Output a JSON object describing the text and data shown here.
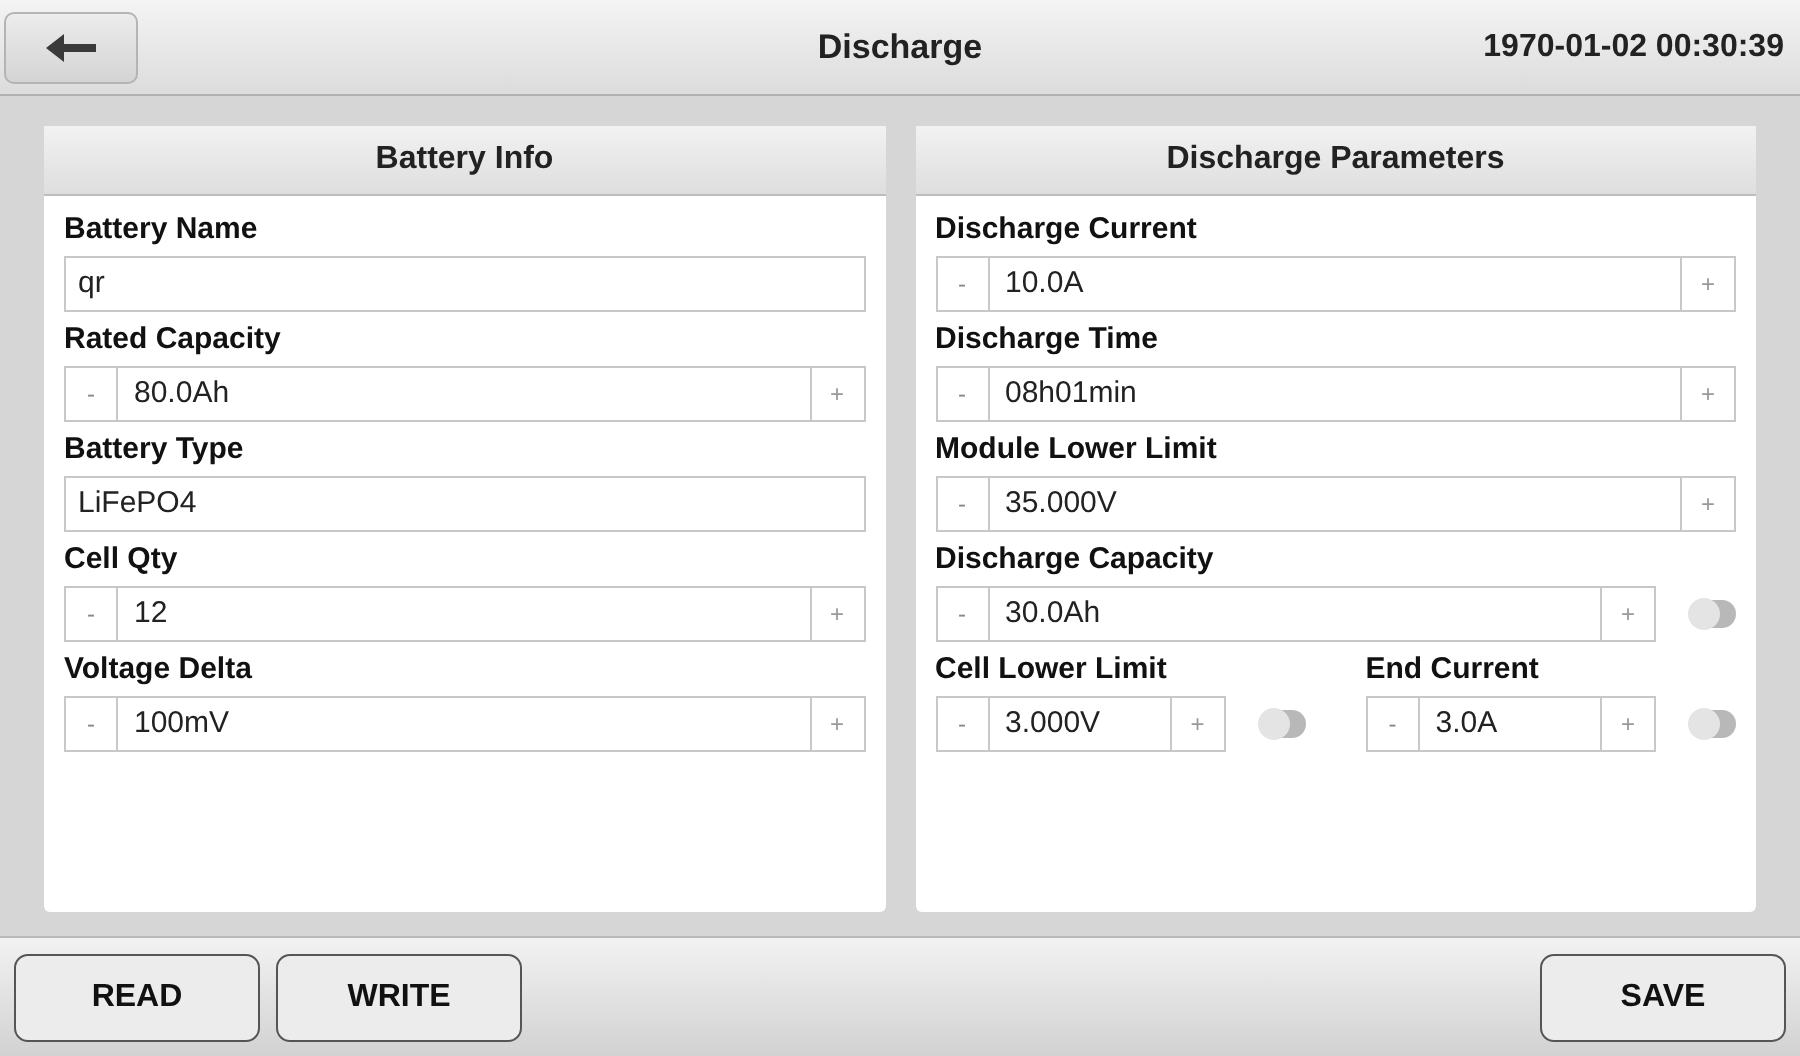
{
  "header": {
    "title": "Discharge",
    "datetime": "1970-01-02 00:30:39"
  },
  "panels": [
    {
      "title": "Battery Info",
      "rows": [
        [
          {
            "label": "Battery Name",
            "kind": "text",
            "value": "qr"
          }
        ],
        [
          {
            "label": "Rated Capacity",
            "kind": "stepper",
            "minus": "-",
            "value": "80.0Ah",
            "plus": "+"
          }
        ],
        [
          {
            "label": "Battery Type",
            "kind": "text",
            "value": "LiFePO4"
          }
        ],
        [
          {
            "label": "Cell Qty",
            "kind": "stepper",
            "minus": "-",
            "value": "12",
            "plus": "+"
          }
        ],
        [
          {
            "label": "Voltage Delta",
            "kind": "stepper",
            "minus": "-",
            "value": "100mV",
            "plus": "+"
          }
        ]
      ]
    },
    {
      "title": "Discharge Parameters",
      "rows": [
        [
          {
            "label": "Discharge Current",
            "kind": "stepper",
            "minus": "-",
            "value": "10.0A",
            "plus": "+"
          }
        ],
        [
          {
            "label": "Discharge Time",
            "kind": "stepper",
            "minus": "-",
            "value": "08h01min",
            "plus": "+"
          }
        ],
        [
          {
            "label": "Module Lower Limit",
            "kind": "stepper",
            "minus": "-",
            "value": "35.000V",
            "plus": "+"
          }
        ],
        [
          {
            "label": "Discharge Capacity",
            "kind": "stepper",
            "minus": "-",
            "value": "30.0Ah",
            "plus": "+",
            "toggle": {
              "on": false
            }
          }
        ],
        [
          {
            "label": "Cell Lower Limit",
            "kind": "stepper",
            "minus": "-",
            "value": "3.000V",
            "plus": "+",
            "toggle": {
              "on": false
            }
          },
          {
            "label": "End Current",
            "kind": "stepper",
            "minus": "-",
            "value": "3.0A",
            "plus": "+",
            "toggle": {
              "on": false
            }
          }
        ]
      ]
    }
  ],
  "footer": {
    "left_buttons": [
      "READ",
      "WRITE"
    ],
    "right_buttons": [
      "SAVE"
    ]
  }
}
